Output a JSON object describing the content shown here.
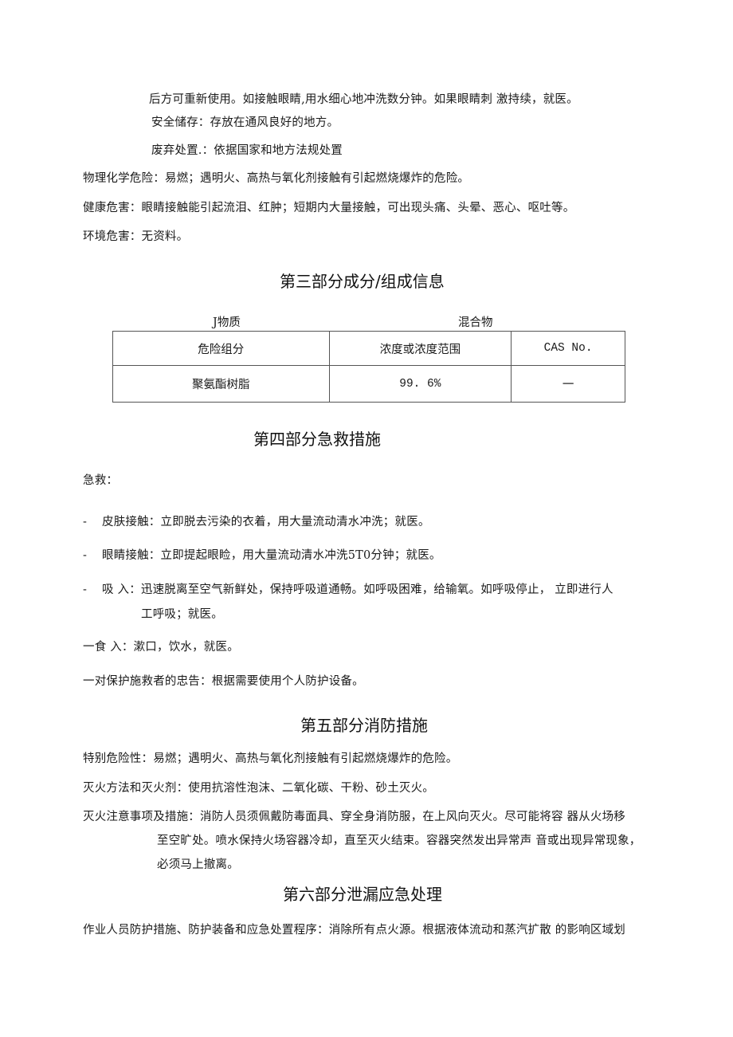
{
  "section2_tail": {
    "line1": "后方可重新使用。如接触眼睛,用水细心地冲洗数分钟。如果眼睛刺 激持续，就医。",
    "storage": "安全储存：存放在通风良好的地方。",
    "disposal": "废弃处置.：依据国家和地方法规处置",
    "physchem_hazard": "物理化学危险：易燃；遇明火、高热与氧化剂接触有引起燃烧爆炸的危险。",
    "health_hazard": "健康危害：眼睛接触能引起流泪、红肿；短期内大量接触，可出现头痛、头晕、恶心、呕吐等。",
    "env_hazard": "环境危害：无资料。"
  },
  "section3": {
    "title": "第三部分成分/组成信息",
    "label_substance": "J物质",
    "label_mixture": "混合物",
    "table": {
      "headers": [
        "危险组分",
        "浓度或浓度范围",
        "CAS No."
      ],
      "rows": [
        [
          "聚氨酯树脂",
          "99. 6%",
          "一"
        ]
      ]
    }
  },
  "section4": {
    "title": "第四部分急救措施",
    "intro": "急救：",
    "items": [
      {
        "bullet": "-",
        "text": "皮肤接触：立即脱去污染的衣着，用大量流动清水冲洗；就医。"
      },
      {
        "bullet": "-",
        "text": "眼睛接触：立即提起眼睑，用大量流动清水冲洗5T0分钟；就医。"
      },
      {
        "bullet": "-",
        "text": "吸  入：迅速脱离至空气新鲜处，保持呼吸道通畅。如呼吸困难，给输氧。如呼吸停止，  立即进行人",
        "continuation": "工呼吸；就医。"
      }
    ],
    "ingestion": "一食  入：漱口，饮水，就医。",
    "rescuer_advice": "一对保护施救者的忠告：根据需要使用个人防护设备。"
  },
  "section5": {
    "title": "第五部分消防措施",
    "special_hazard": "特别危险性：易燃；遇明火、高热与氧化剂接触有引起燃烧爆炸的危险。",
    "extinguishing": "灭火方法和灭火剂：使用抗溶性泡沫、二氧化碳、干粉、砂土灭火。",
    "precautions_line1": "灭火注意事项及措施：消防人员须佩戴防毒面具、穿全身消防服，在上风向灭火。尽可能将容 器从火场移",
    "precautions_line2": "至空旷处。喷水保持火场容器冷却，直至灭火结束。容器突然发出异常声 音或出现异常现象，",
    "precautions_line3": "必须马上撤离。"
  },
  "section6": {
    "title": "第六部分泄漏应急处理",
    "personnel_line1": "作业人员防护措施、防护装备和应急处置程序：消除所有点火源。根据液体流动和蒸汽扩散 的影响区域划"
  }
}
